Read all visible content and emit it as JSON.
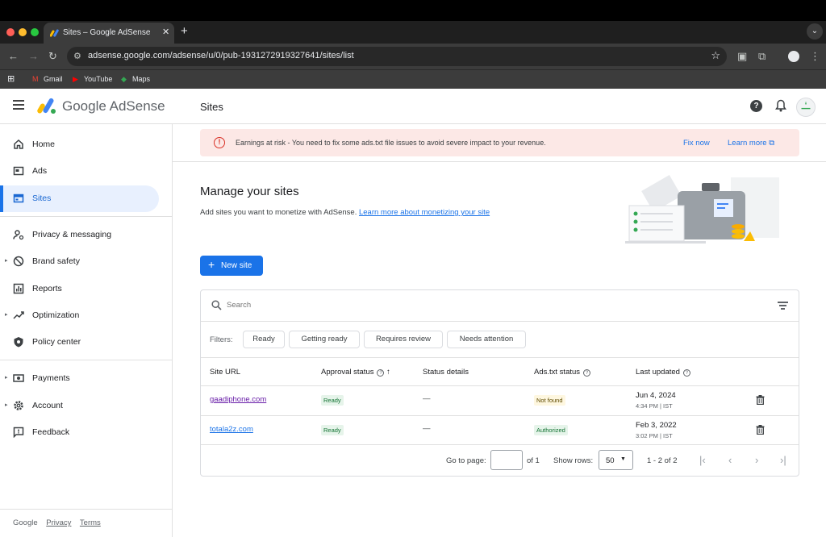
{
  "browser": {
    "tab_title": "Sites – Google AdSense",
    "url": "adsense.google.com/adsense/u/0/pub-1931272919327641/sites/list",
    "bookmarks": [
      "Gmail",
      "YouTube",
      "Maps"
    ],
    "traffic_colors": [
      "#ff5f57",
      "#febc2e",
      "#28c840"
    ]
  },
  "app": {
    "brand": "Google AdSense",
    "page_title": "Sites",
    "accent": "#1a73e8"
  },
  "sidebar": {
    "items": [
      {
        "label": "Home",
        "icon": "home-icon"
      },
      {
        "label": "Ads",
        "icon": "ads-icon"
      },
      {
        "label": "Sites",
        "icon": "sites-icon",
        "active": true
      },
      {
        "label": "Privacy & messaging",
        "icon": "privacy-icon"
      },
      {
        "label": "Brand safety",
        "icon": "block-icon"
      },
      {
        "label": "Reports",
        "icon": "reports-icon"
      },
      {
        "label": "Optimization",
        "icon": "trending-icon"
      },
      {
        "label": "Policy center",
        "icon": "policy-icon"
      },
      {
        "label": "Payments",
        "icon": "payments-icon"
      },
      {
        "label": "Account",
        "icon": "gear-icon"
      },
      {
        "label": "Feedback",
        "icon": "feedback-icon"
      }
    ],
    "footer": {
      "brand": "Google",
      "privacy": "Privacy",
      "terms": "Terms"
    }
  },
  "alert": {
    "text": "Earnings at risk - You need to fix some ads.txt file issues to avoid severe impact to your revenue.",
    "fix": "Fix now",
    "learn": "Learn more"
  },
  "manage": {
    "title": "Manage your sites",
    "subtitle": "Add sites you want to monetize with AdSense.",
    "link": "Learn more about monetizing your site",
    "new_site": "New site"
  },
  "table": {
    "search_placeholder": "Search",
    "filters_label": "Filters:",
    "filters": [
      "Ready",
      "Getting ready",
      "Requires review",
      "Needs attention"
    ],
    "headers": {
      "url": "Site URL",
      "approval": "Approval status",
      "details": "Status details",
      "ads_txt": "Ads.txt status",
      "updated": "Last updated"
    },
    "rows": [
      {
        "url": "gaadiphone.com",
        "approval": "Ready",
        "details": "—",
        "ads_txt": "Not found",
        "date": "Jun 4, 2024",
        "time": "4:34 PM | IST"
      },
      {
        "url": "totala2z.com",
        "approval": "Ready",
        "details": "—",
        "ads_txt": "Authorized",
        "date": "Feb 3, 2022",
        "time": "3:02 PM | IST"
      }
    ],
    "pagination": {
      "goto": "Go to page:",
      "of": "of 1",
      "show_rows": "Show rows:",
      "rows": "50",
      "range": "1 - 2 of 2"
    }
  }
}
